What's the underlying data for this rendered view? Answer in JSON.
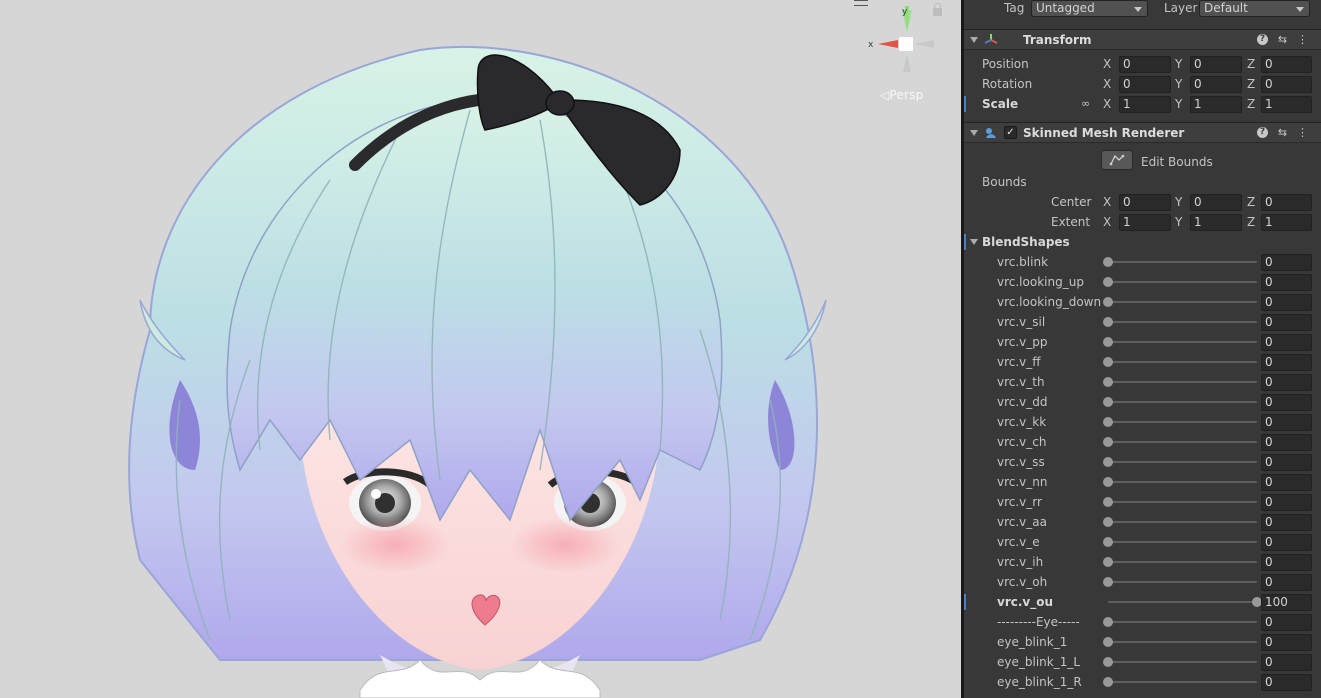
{
  "scene": {
    "persp_label": "◁Persp",
    "gizmo": {
      "y_label": "y",
      "x_label": "x"
    }
  },
  "inspector": {
    "tag_label": "Tag",
    "tag_value": "Untagged",
    "layer_label": "Layer",
    "layer_value": "Default",
    "transform": {
      "title": "Transform",
      "rows": [
        {
          "label": "Position",
          "x": "0",
          "y": "0",
          "z": "0"
        },
        {
          "label": "Rotation",
          "x": "0",
          "y": "0",
          "z": "0"
        },
        {
          "label": "Scale",
          "x": "1",
          "y": "1",
          "z": "1"
        }
      ]
    },
    "skinned": {
      "title": "Skinned Mesh Renderer",
      "edit_bounds_label": "Edit Bounds",
      "bounds_label": "Bounds",
      "center": {
        "label": "Center",
        "x": "0",
        "y": "0",
        "z": "0"
      },
      "extent": {
        "label": "Extent",
        "x": "1",
        "y": "1",
        "z": "1"
      },
      "blendshapes_label": "BlendShapes",
      "blendshapes": [
        {
          "name": "vrc.blink",
          "value": 0
        },
        {
          "name": "vrc.looking_up",
          "value": 0
        },
        {
          "name": "vrc.looking_down",
          "value": 0
        },
        {
          "name": "vrc.v_sil",
          "value": 0
        },
        {
          "name": "vrc.v_pp",
          "value": 0
        },
        {
          "name": "vrc.v_ff",
          "value": 0
        },
        {
          "name": "vrc.v_th",
          "value": 0
        },
        {
          "name": "vrc.v_dd",
          "value": 0
        },
        {
          "name": "vrc.v_kk",
          "value": 0
        },
        {
          "name": "vrc.v_ch",
          "value": 0
        },
        {
          "name": "vrc.v_ss",
          "value": 0
        },
        {
          "name": "vrc.v_nn",
          "value": 0
        },
        {
          "name": "vrc.v_rr",
          "value": 0
        },
        {
          "name": "vrc.v_aa",
          "value": 0
        },
        {
          "name": "vrc.v_e",
          "value": 0
        },
        {
          "name": "vrc.v_ih",
          "value": 0
        },
        {
          "name": "vrc.v_oh",
          "value": 0
        },
        {
          "name": "vrc.v_ou",
          "value": 100
        },
        {
          "name": "---------Eye-----",
          "value": 0
        },
        {
          "name": "eye_blink_1",
          "value": 0
        },
        {
          "name": "eye_blink_1_L",
          "value": 0
        },
        {
          "name": "eye_blink_1_R",
          "value": 0
        }
      ]
    }
  },
  "colors": {
    "scene_bg": "#d6d6d6",
    "inspector_bg": "#383838",
    "accent": "#4d80c9",
    "hair_top": "#cfeee2",
    "hair_mid": "#b9dbe6",
    "hair_bottom": "#b8b6ee",
    "bow": "#2a2a2e"
  }
}
